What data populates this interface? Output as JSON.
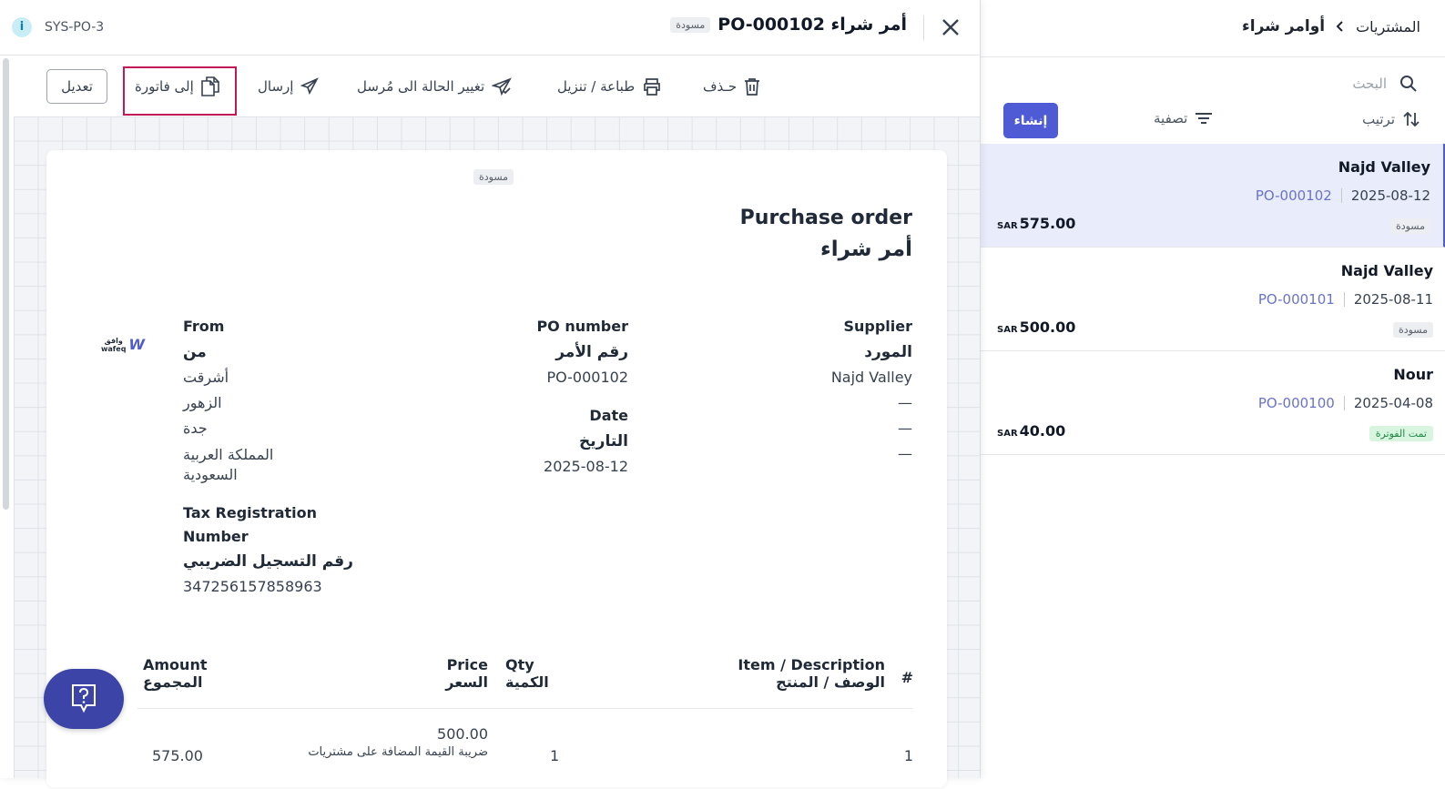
{
  "list": {
    "breadcrumb": "المشتريات",
    "page_title": "أوامر شراء",
    "search_placeholder": "البحث",
    "sort_label": "ترتيب",
    "filter_label": "تصفية",
    "create_label": "إنشاء",
    "items": [
      {
        "name": "Najd Valley",
        "po": "PO-000102",
        "date": "2025-08-12",
        "status": "مسودة",
        "status_type": "draft",
        "currency": "SAR",
        "amount": "575.00",
        "selected": true
      },
      {
        "name": "Najd Valley",
        "po": "PO-000101",
        "date": "2025-08-11",
        "status": "مسودة",
        "status_type": "draft",
        "currency": "SAR",
        "amount": "500.00",
        "selected": false
      },
      {
        "name": "Nour",
        "po": "PO-000100",
        "date": "2025-04-08",
        "status": "تمت الفوترة",
        "status_type": "invoiced",
        "currency": "SAR",
        "amount": "40.00",
        "selected": false
      }
    ]
  },
  "detail": {
    "code": "SYS-PO-3",
    "title": "أمر شراء PO-000102",
    "status_badge": "مسودة",
    "toolbar": {
      "delete": "حـذف",
      "print": "طباعة / تنزيل",
      "change_status": "تغيير الحالة الى مُرسل",
      "send": "إرسال",
      "to_invoice": "إلى فاتورة",
      "edit": "تعديل"
    },
    "doc": {
      "stamp": "مسودة",
      "title_en": "Purchase order",
      "title_ar": "أمر شراء",
      "supplier_label_en": "Supplier",
      "supplier_label_ar": "المورد",
      "supplier_name": "Najd Valley",
      "supplier_lines": [
        "—",
        "—",
        "—"
      ],
      "po_label_en": "PO number",
      "po_label_ar": "رقم الأمر",
      "po_value": "PO-000102",
      "date_label_en": "Date",
      "date_label_ar": "التاريخ",
      "date_value": "2025-08-12",
      "from_label_en": "From",
      "from_label_ar": "من",
      "from_lines": [
        "أشرقت",
        "الزهور",
        "جدة",
        "المملكة العربية",
        "السعودية"
      ],
      "tax_label_en_1": "Tax Registration",
      "tax_label_en_2": "Number",
      "tax_label_ar": "رقم التسجيل الضريبي",
      "tax_value": "347256157858963",
      "logo_text_ar": "وافق",
      "logo_text_en": "wafeq",
      "table": {
        "col_num": "#",
        "col_item_en": "Item / Description",
        "col_item_ar": "الوصف / المنتج",
        "col_qty_en": "Qty",
        "col_qty_ar": "الكمية",
        "col_price_en": "Price",
        "col_price_ar": "السعر",
        "col_amount_en": "Amount",
        "col_amount_ar": "المجموع",
        "rows": [
          {
            "num": "1",
            "qty": "1",
            "price": "500.00",
            "tax_note": "ضريبة القيمة المضافة على مشتريات",
            "amount": "575.00"
          }
        ]
      }
    }
  },
  "icons": {
    "search": "search-icon",
    "sort": "sort-arrows-icon",
    "filter": "filter-lines-icon",
    "close": "close-icon",
    "trash": "trash-icon",
    "printer": "printer-icon",
    "send_check": "send-check-icon",
    "send": "send-icon",
    "document_copy": "document-copy-icon",
    "help": "help-chat-icon",
    "info": "info-icon",
    "chevron": "chevron-left-icon"
  },
  "colors": {
    "accent": "#4f5bd5",
    "selected_bg": "#e9ecfa",
    "highlight_frame": "#c2185b",
    "invoiced_bg": "#d7f5df",
    "invoiced_text": "#1e8a45"
  }
}
